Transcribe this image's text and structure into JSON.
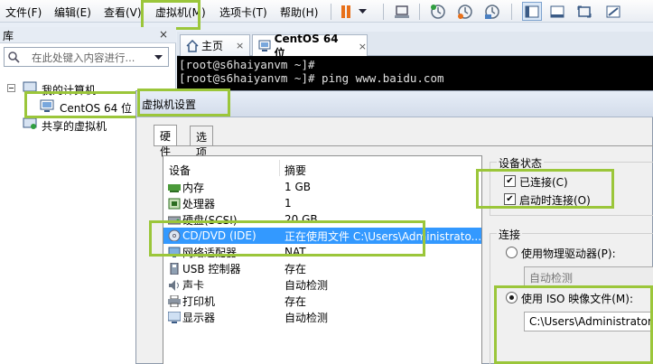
{
  "menubar": {
    "items": [
      "文件(F)",
      "编辑(E)",
      "查看(V)",
      "虚拟机(M)",
      "选项卡(T)",
      "帮助(H)"
    ]
  },
  "toolbar": {
    "icons": [
      "pause-icon",
      "dropdown-icon",
      "send-keys-icon",
      "snapshot-icon",
      "revert-snapshot-icon",
      "snapshot-manager-icon",
      "console-view-icon",
      "full-screen-icon",
      "fit-window-icon",
      "unity-icon"
    ]
  },
  "library": {
    "title": "库",
    "close": "×",
    "search_placeholder": "在此处键入内容进行...",
    "tree": {
      "my_computer": "我的计算机",
      "vm": "CentOS 64 位",
      "shared": "共享的虚拟机"
    }
  },
  "tabs": [
    {
      "label": "主页",
      "icon": "home-icon",
      "close": "×"
    },
    {
      "label": "CentOS 64 位",
      "icon": "vm-icon",
      "close": "×"
    }
  ],
  "terminal": {
    "lines": [
      "[root@s6haiyanvm ~]#",
      "[root@s6haiyanvm ~]# ping www.baidu.com"
    ]
  },
  "dialog": {
    "title": "虚拟机设置",
    "tabs": [
      "硬件",
      "选项"
    ],
    "hardware": {
      "col_device": "设备",
      "col_summary": "摘要",
      "rows": [
        {
          "name": "内存",
          "summary": "1 GB",
          "icon": "memory-icon"
        },
        {
          "name": "处理器",
          "summary": "1",
          "icon": "cpu-icon"
        },
        {
          "name": "硬盘(SCSI)",
          "summary": "20 GB",
          "icon": "hard-disk-icon"
        },
        {
          "name": "CD/DVD (IDE)",
          "summary": "正在使用文件 C:\\Users\\Administrato...",
          "icon": "cd-dvd-icon",
          "selected": true
        },
        {
          "name": "网络适配器",
          "summary": "NAT",
          "icon": "network-icon"
        },
        {
          "name": "USB 控制器",
          "summary": "存在",
          "icon": "usb-icon"
        },
        {
          "name": "声卡",
          "summary": "自动检测",
          "icon": "sound-icon"
        },
        {
          "name": "打印机",
          "summary": "存在",
          "icon": "printer-icon"
        },
        {
          "name": "显示器",
          "summary": "自动检测",
          "icon": "display-icon"
        }
      ]
    },
    "device_status": {
      "title": "设备状态",
      "connected": "已连接(C)",
      "connect_on_power_on": "启动时连接(O)"
    },
    "connection": {
      "title": "连接",
      "physical_drive": "使用物理驱动器(P):",
      "auto_detect": "自动检测",
      "use_iso": "使用 ISO 映像文件(M):",
      "iso_path": "C:\\Users\\Administrator\\Dc"
    }
  },
  "colors": {
    "highlight": "#9bc63a",
    "selection": "#3399ff"
  }
}
